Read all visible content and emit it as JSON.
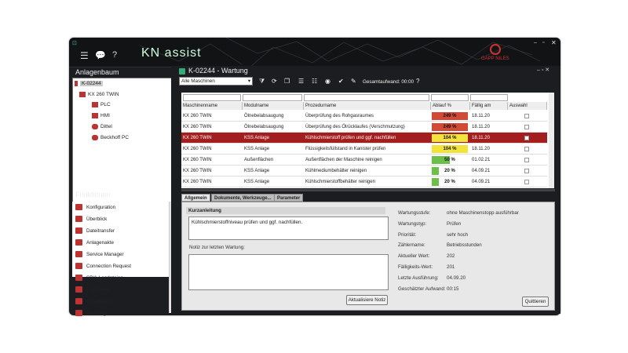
{
  "app": {
    "logo": "KN assist",
    "brand": "GAPP NILES"
  },
  "left": {
    "title": "Anlagenbaum",
    "tree": [
      {
        "label": "K-02244"
      },
      {
        "label": "KX 260 TWIN"
      },
      {
        "label": "PLC"
      },
      {
        "label": "HMI"
      },
      {
        "label": "Dittel"
      },
      {
        "label": "Beckhoff PC"
      }
    ]
  },
  "functions": {
    "title": "Funktionen",
    "items": [
      "Konfiguration",
      "Überblick",
      "Dateitransfer",
      "Anlagenakte",
      "Service Manager",
      "Connection Request",
      "SP/1-Logdateien",
      "Logdateien",
      "Dashboard",
      "Wartung"
    ]
  },
  "main": {
    "title": "K-02244 - Wartung",
    "machine_filter": "Alle Maschinen",
    "gesamtaufwand": "Gesamtaufwand: 00:00",
    "help": "?"
  },
  "grid": {
    "headers": [
      "Maschinenname",
      "Modulname",
      "Prozedurname",
      "Ablauf %",
      "Fällig am",
      "Auswahl"
    ],
    "rows": [
      {
        "machine": "KX 260 TWIN",
        "module": "Ölnebelabsaugung",
        "procedure": "Überprüfung des Rohgasraumes",
        "pct": "249 %",
        "pct_val": 249,
        "due": "18.11.20",
        "color": "#d24a36"
      },
      {
        "machine": "KX 260 TWIN",
        "module": "Ölnebelabsaugung",
        "procedure": "Überprüfung des Ölrücklaufes (Verschmutzung)",
        "pct": "249 %",
        "pct_val": 249,
        "due": "18.11.20",
        "color": "#d24a36"
      },
      {
        "machine": "KX 260 TWIN",
        "module": "KSS Anlage",
        "procedure": "Kühlschmierstoff prüfen und ggf. nachfüllen",
        "pct": "104 %",
        "pct_val": 104,
        "due": "18.11.20",
        "color": "#f2e33a",
        "selected": true
      },
      {
        "machine": "KX 260 TWIN",
        "module": "KSS Anlage",
        "procedure": "Flüssigkeitsfüllstand in Kanister prüfen",
        "pct": "104 %",
        "pct_val": 104,
        "due": "18.11.20",
        "color": "#f2e33a"
      },
      {
        "machine": "KX 260 TWIN",
        "module": "Außenflächen",
        "procedure": "Außenflächen der Maschine reinigen",
        "pct": "50 %",
        "pct_val": 50,
        "due": "01.02.21",
        "color": "#6cc04a"
      },
      {
        "machine": "KX 260 TWIN",
        "module": "KSS Anlage",
        "procedure": "Kühlmediumbehälter reinigen",
        "pct": "20 %",
        "pct_val": 20,
        "due": "04.09.21",
        "color": "#6cc04a"
      },
      {
        "machine": "KX 260 TWIN",
        "module": "KSS Anlage",
        "procedure": "Kühlschmierstoffbehälter reinigen",
        "pct": "20 %",
        "pct_val": 20,
        "due": "04.09.21",
        "color": "#6cc04a"
      }
    ]
  },
  "tabs": [
    "Allgemein",
    "Dokumente, Werkzeuge...",
    "Parameter"
  ],
  "detail": {
    "kurz_title": "Kurzanleitung",
    "kurz_text": "Kühlschmierstoffniveau prüfen und ggf. nachfüllen.",
    "notiz_label": "Notiz zur letzten Wartung:",
    "update_btn": "Aktualisiere Notiz",
    "quit_btn": "Quittieren",
    "fields": [
      {
        "k": "Wartungsstufe:",
        "v": "ohne Maschinenstopp ausführbar"
      },
      {
        "k": "Wartungstyp:",
        "v": "Prüfen"
      },
      {
        "k": "Priorität:",
        "v": "sehr hoch"
      },
      {
        "k": "Zählername:",
        "v": "Betriebsstunden"
      },
      {
        "k": "Aktueller Wert:",
        "v": "202"
      },
      {
        "k": "Fälligkeits-Wert:",
        "v": "201"
      },
      {
        "k": "Letzte Ausführung:",
        "v": "04.09.20"
      },
      {
        "k": "Geschätzter Aufwand:",
        "v": "00:15"
      }
    ]
  }
}
